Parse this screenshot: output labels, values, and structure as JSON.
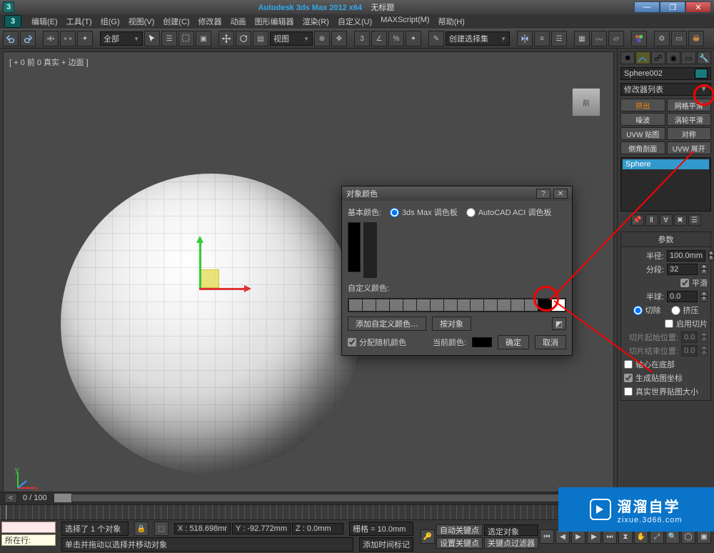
{
  "titlebar": {
    "app_name": "Autodesk 3ds Max 2012 x64",
    "doc": "无标题"
  },
  "menubar": {
    "items": [
      "编辑(E)",
      "工具(T)",
      "组(G)",
      "视图(V)",
      "创建(C)",
      "修改器",
      "动画",
      "图形编辑器",
      "渲染(R)",
      "自定义(U)",
      "MAXScript(M)",
      "帮助(H)"
    ]
  },
  "toolbar": {
    "drop_all": "全部",
    "drop_view": "视图",
    "drop_selset": "创建选择集"
  },
  "viewport": {
    "label": "[ + 0 前 0 真实 + 边面 ]",
    "viewcube_face": "前"
  },
  "cmdpanel": {
    "object_name": "Sphere002",
    "modlist_placeholder": "修改器列表",
    "mod_buttons": [
      "挤出",
      "网格平滑",
      "噪波",
      "涡轮平滑",
      "UVW 贴图",
      "对称",
      "倒角剖面",
      "UVW 展开"
    ],
    "stack_item": "Sphere",
    "rollout_title": "参数",
    "params": {
      "radius_label": "半径:",
      "radius_value": "100.0mm",
      "segments_label": "分段:",
      "segments_value": "32",
      "smooth_label": "平滑",
      "hemisphere_label": "半球:",
      "hemisphere_value": "0.0",
      "chop_label": "切除",
      "squash_label": "挤压",
      "sliceon_label": "启用切片",
      "slice_from_label": "切片起始位置:",
      "slice_from_value": "0.0",
      "slice_to_label": "切片结束位置:",
      "slice_to_value": "0.0",
      "basepivot_label": "轴心在底部",
      "genmap_label": "生成贴图坐标",
      "realworld_label": "真实世界贴图大小"
    }
  },
  "dialog": {
    "title": "对象颜色",
    "basic_colors": "基本颜色:",
    "palette_3dsmax": "3ds Max 调色板",
    "palette_aci": "AutoCAD ACI 调色板",
    "custom_colors": "自定义颜色:",
    "add_custom": "添加自定义颜色…",
    "by_object": "按对象",
    "assign_random": "分配随机颜色",
    "current_color": "当前颜色:",
    "ok": "确定",
    "cancel": "取消",
    "swatches": [
      "#2b2b2b",
      "#5b1818",
      "#7c2a12",
      "#8a5a10",
      "#7a7a10",
      "#4a7a10",
      "#107a3a",
      "#107a7a",
      "#104a7a",
      "#1a1a7a",
      "#4a107a",
      "#7a105b",
      "#aaa",
      "#d44",
      "#e83",
      "#ed5",
      "#dd5",
      "#9d5",
      "#5da",
      "#5dd",
      "#5ad",
      "#77e",
      "#a7e",
      "#e7b",
      "#ccc",
      "#f66",
      "#fa6",
      "#fe6",
      "#ef6",
      "#be6",
      "#7ec",
      "#7ee",
      "#9cf",
      "#99f",
      "#c9f",
      "#f9d",
      "#eee",
      "#f99",
      "#fc9",
      "#ff9",
      "#ef9",
      "#cf9",
      "#9fc",
      "#9ff",
      "#bdf",
      "#ccf",
      "#dcf",
      "#fce",
      "#666",
      "#833",
      "#853",
      "#873",
      "#773",
      "#573",
      "#375",
      "#377",
      "#357",
      "#337",
      "#537",
      "#735",
      "#999",
      "#b55",
      "#b85",
      "#bb5",
      "#9b5",
      "#5b8",
      "#5bb",
      "#58b",
      "#55b",
      "#85b",
      "#b58",
      "#000",
      "#444",
      "#622",
      "#642",
      "#662",
      "#462",
      "#264",
      "#266",
      "#246"
    ]
  },
  "timeline": {
    "frame_label": "0 / 100"
  },
  "status": {
    "nowrow": "所在行:",
    "msg1": "选择了 1 个对象",
    "msg2": "单击并拖动以选择并移动对象",
    "x_label": "X :",
    "x_val": "518.698mr",
    "y_label": "Y :",
    "y_val": "-92.772mm",
    "z_label": "Z :",
    "z_val": "0.0mm",
    "grid_label": "栅格 = 10.0mm",
    "autokey": "自动关键点",
    "selset": "选定对象",
    "setkey": "设置关键点",
    "keyfilter": "关键点过滤器",
    "addtag": "添加时间标记"
  },
  "watermark": {
    "big": "溜溜自学",
    "small": "zixue.3d66.com"
  }
}
